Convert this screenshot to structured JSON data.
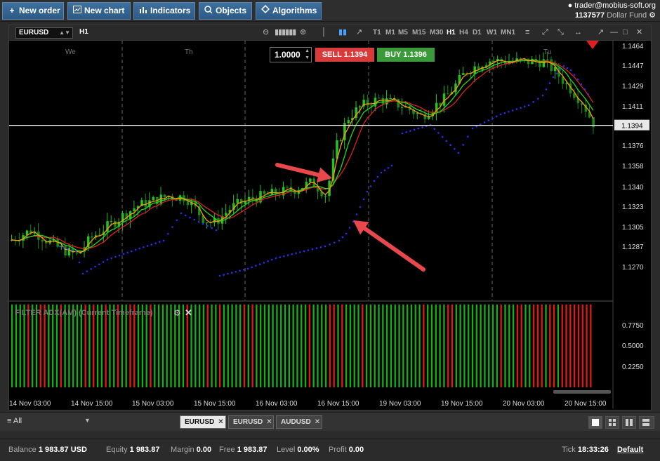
{
  "toolbar": {
    "new_order": "New order",
    "new_chart": "New chart",
    "indicators": "Indicators",
    "objects": "Objects",
    "algorithms": "Algorithms"
  },
  "account": {
    "email": "trader@mobius-soft.org",
    "number": "1137577",
    "fund": "Dollar Fund"
  },
  "chart": {
    "symbol": "EURUSD",
    "timeframe": "H1",
    "timeframes": [
      "T1",
      "M1",
      "M5",
      "M15",
      "M30",
      "H1",
      "H4",
      "D1",
      "W1",
      "MN1"
    ],
    "active_timeframe": "H1",
    "lot": "1.0000",
    "sell_label": "SELL 1.1394",
    "buy_label": "BUY 1.1396",
    "current_price": "1.1394",
    "price_labels": [
      "1.1464",
      "1.1447",
      "1.1429",
      "1.1411",
      "1.1376",
      "1.1358",
      "1.1340",
      "1.1323",
      "1.1305",
      "1.1287",
      "1.1270"
    ],
    "day_labels": [
      "We",
      "Th",
      "Tu"
    ],
    "time_labels": [
      "14 Nov 03:00",
      "14 Nov 15:00",
      "15 Nov 03:00",
      "15 Nov 15:00",
      "16 Nov 03:00",
      "16 Nov 15:00",
      "19 Nov 03:00",
      "19 Nov 15:00",
      "20 Nov 03:00",
      "20 Nov 15:00"
    ],
    "indicator_name": "FILTER ADX(AM) (Current Timeframe)",
    "indicator_levels": [
      "0.7750",
      "0.5000",
      "0.2250"
    ],
    "colors": {
      "bull": "#22c322",
      "bear": "#178a17",
      "sell": "#d93a3a",
      "buy": "#3a9a3a",
      "fast_ma": "#ff9a00",
      "slow_ma": "#e02020",
      "mid_ma": "#22d822",
      "sar": "#2233ee",
      "arrow": "#e8484c"
    },
    "indicator_bars": "GGGGRGGRRGGGRGGGGGRGRGGRGGRGGRRGGGRGGGGGGGGRGGGGRGGRGGGGGRGRGGGGGGGGGGGGGRGGGGRRGRGGGGRGGGGGGGGGGGGGGRGGGGGRRGGGGGGGGGGGRGGGRRGGRRRGRRGRRRRRRRR"
  },
  "tabs": {
    "filter": "All",
    "symbols": [
      "EURUSD",
      "EURUSD",
      "AUDUSD"
    ],
    "active_index": 0
  },
  "status": {
    "balance_label": "Balance",
    "balance": "1 983.87",
    "currency": "USD",
    "equity_label": "Equity",
    "equity": "1 983.87",
    "margin_label": "Margin",
    "margin": "0.00",
    "free_label": "Free",
    "free": "1 983.87",
    "level_label": "Level",
    "level": "0.00%",
    "profit_label": "Profit",
    "profit": "0.00",
    "tick_label": "Tick",
    "time": "18:33:26",
    "profile": "Default"
  }
}
